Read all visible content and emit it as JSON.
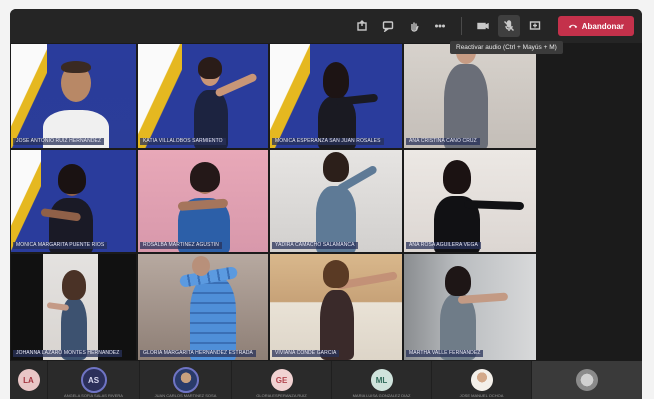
{
  "toolbar": {
    "buttons": [
      {
        "name": "share-tray-icon"
      },
      {
        "name": "chat-icon"
      },
      {
        "name": "raise-hand-icon"
      },
      {
        "name": "more-options-icon"
      },
      {
        "name": "camera-icon"
      },
      {
        "name": "microphone-icon"
      },
      {
        "name": "share-screen-icon"
      }
    ],
    "leave_label": "Abandonar",
    "tooltip": "Reactivar audio (Ctrl + Mayús + M)"
  },
  "tiles": [
    {
      "name": "JOSE ANTONIO RUIZ HERNANDEZ"
    },
    {
      "name": "KATIA VILLALOBOS SARMIENTO"
    },
    {
      "name": "MONICA ESPERANZA SAN JUAN ROSALES"
    },
    {
      "name": "ANA CRISTINA CANO CRUZ"
    },
    {
      "name": "MONICA MARGARITA PUENTE RIOS"
    },
    {
      "name": "ROSALBA MARTINEZ AGUSTIN"
    },
    {
      "name": "YADIRA CAMACHO SALAMANCA"
    },
    {
      "name": "ANA ROSA AGUILERA VEGA"
    },
    {
      "name": "JOHANNA LAZARO MONTES HERNANDEZ"
    },
    {
      "name": "GLORIA MARGARITA HERNANDEZ ESTRADA"
    },
    {
      "name": "VIVIANA CONDE GARCIA"
    },
    {
      "name": "MARTHA VALLE FERNANDEZ"
    }
  ],
  "participants_bar": [
    {
      "initials": "LA",
      "label": ""
    },
    {
      "initials": "AS",
      "label": "ANGELA SOFIA SALAS RIVERA"
    },
    {
      "initials": "",
      "label": "JUAN CARLOS MARTINEZ SOSA"
    },
    {
      "initials": "GE",
      "label": "GLORIA ESPERANZA RUIZ"
    },
    {
      "initials": "ML",
      "label": "MARIA LUISA GONZALEZ DIAZ"
    },
    {
      "initials": "",
      "label": "JOSE MANUEL OCHOA"
    },
    {
      "initials": "",
      "label": ""
    }
  ],
  "colors": {
    "leave": "#c4314b",
    "toolbar_bg": "#252525",
    "name_tag_bg": "#28325a"
  }
}
